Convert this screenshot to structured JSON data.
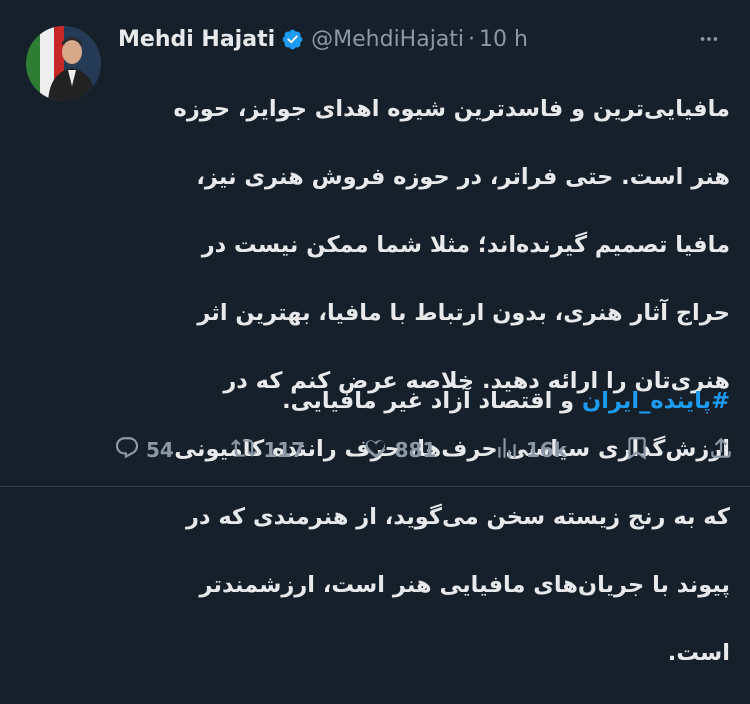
{
  "tweet": {
    "author_name": "Mehdi Hajati",
    "handle": "@MehdiHajati",
    "separator": "·",
    "time": "10 h",
    "text_lines": [
      "مافیایی‌ترین و فاسدترین شیوه اهدای جوایز، حوزه",
      "هنر است. حتی فراتر، در حوزه فروش هنری نیز،",
      "مافیا تصمیم گیرنده‌اند؛ مثلا شما ممکن نیست در",
      "حراج آثار هنری، بدون ارتباط با مافیا، بهترین اثر",
      "هنری‌تان را ارائه دهید. خلاصه عرض کنم که در",
      "ارزش‌گذاری سیاسی حرف‌ها، حرف راننده کامیونی",
      "که به رنج زیسته سخن می‌گوید، از هنرمندی که در",
      "پیوند با جریان‌های مافیایی هنر است، ارزشمندتر",
      "است."
    ],
    "hashtag": "#پاینده_ایران",
    "hashtag_suffix": " و اقتصاد آزاد غیر مافیایی."
  },
  "actions": {
    "replies": "54",
    "retweets": "117",
    "likes": "881",
    "views": "16k"
  },
  "colors": {
    "background": "#15202b",
    "text": "#e7e9ea",
    "muted": "#8b98a5",
    "accent": "#1d9bf0"
  },
  "icons": [
    "verified-badge-icon",
    "more-icon",
    "reply-icon",
    "retweet-icon",
    "like-icon",
    "views-icon",
    "bookmark-icon",
    "share-icon"
  ]
}
